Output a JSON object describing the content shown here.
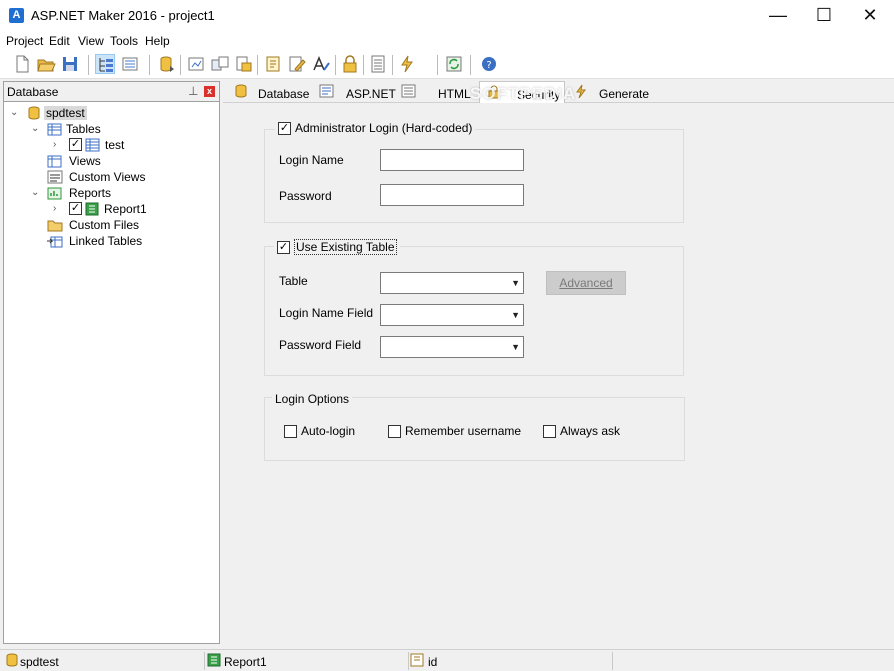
{
  "window": {
    "title": "ASP.NET Maker 2016 - project1",
    "icon": "aspnetmaker-app-icon",
    "icon_letter": "A",
    "minimize_label": "—",
    "maximize_label": "☐",
    "close_label": "✕"
  },
  "menu": {
    "items": [
      {
        "label": "Project"
      },
      {
        "label": "Edit"
      },
      {
        "label": "View"
      },
      {
        "label": "Tools"
      },
      {
        "label": "Help"
      }
    ]
  },
  "toolbar": {
    "buttons": [
      "new-icon",
      "open-icon",
      "save-icon",
      "tree-view-icon",
      "list-view-icon",
      "database-icon",
      "connect-icon",
      "sync-icon",
      "export-icon",
      "settings-icon",
      "edit-icon",
      "fonts-icon",
      "security-icon",
      "template-icon",
      "generate-icon",
      "refresh-icon",
      "help-icon"
    ]
  },
  "left_panel": {
    "title": "Database",
    "pin_glyph": "⊥",
    "close_glyph": "x",
    "tree": {
      "root": "spdtest",
      "tables": "Tables",
      "table_item": "test",
      "views": "Views",
      "custom_views": "Custom Views",
      "reports": "Reports",
      "report_item": "Report1",
      "custom_files": "Custom Files",
      "linked_tables": "Linked Tables",
      "expanded_glyph": "⌄",
      "collapsed_glyph": "›"
    }
  },
  "tabs": [
    {
      "label": "Database",
      "icon": "database-icon"
    },
    {
      "label": "ASP.NET",
      "icon": "aspnet-icon"
    },
    {
      "label": "HTML",
      "icon": "html-icon"
    },
    {
      "label": "Security",
      "icon": "security-icon"
    },
    {
      "label": "Generate",
      "icon": "generate-icon"
    }
  ],
  "active_tab": "Security",
  "watermark": "SOFTPEDIA",
  "security": {
    "admin_login": {
      "label": "Administrator Login (Hard-coded)",
      "checked": true
    },
    "login_name_label": "Login Name",
    "login_name_value": "",
    "password_label": "Password",
    "password_value": "",
    "use_existing": {
      "label": "Use Existing Table",
      "checked": true
    },
    "table_label": "Table",
    "table_value": "",
    "advanced_label": "Advanced",
    "login_name_field_label": "Login Name Field",
    "login_name_field_value": "",
    "password_field_label": "Password Field",
    "password_field_value": "",
    "login_options_label": "Login Options",
    "auto_login_label": "Auto-login",
    "remember_label": "Remember username",
    "always_ask_label": "Always ask",
    "check_glyph": "✓",
    "dropdown_glyph": "▼"
  },
  "status": {
    "database": "spdtest",
    "report": "Report1",
    "field": "id"
  }
}
